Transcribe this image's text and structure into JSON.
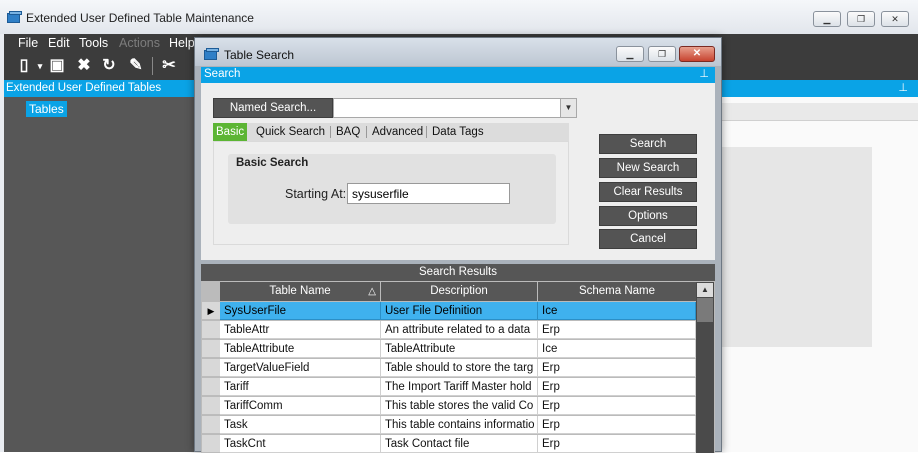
{
  "main": {
    "title": "Extended User Defined Table Maintenance",
    "menu": [
      "File",
      "Edit",
      "Tools",
      "Actions",
      "Help"
    ],
    "panel_title": "Extended User Defined Tables",
    "tree_item": "Tables"
  },
  "dialog": {
    "title": "Table Search",
    "search_panel_title": "Search",
    "named_search_label": "Named Search...",
    "named_search_value": "",
    "tabs": [
      "Basic",
      "Quick Search",
      "BAQ",
      "Advanced",
      "Data Tags"
    ],
    "basic_group_title": "Basic Search",
    "starting_at_label": "Starting At:",
    "starting_at_value": "sysuserfile",
    "buttons": [
      "Search",
      "New Search",
      "Clear Results",
      "Options",
      "Cancel"
    ],
    "results_title": "Search Results",
    "columns": [
      "Table Name",
      "Description",
      "Schema Name"
    ],
    "rows": [
      [
        "SysUserFile",
        "User File Definition",
        "Ice"
      ],
      [
        "TableAttr",
        "An attribute related to a data",
        "Erp"
      ],
      [
        "TableAttribute",
        "TableAttribute",
        "Ice"
      ],
      [
        "TargetValueField",
        "Table should to store the targ",
        "Erp"
      ],
      [
        "Tariff",
        "The Import Tariff Master hold",
        "Erp"
      ],
      [
        "TariffComm",
        "This table stores the valid Co",
        "Erp"
      ],
      [
        "Task",
        "This table contains informatio",
        "Erp"
      ],
      [
        "TaskCnt",
        "Task Contact file",
        "Erp"
      ]
    ],
    "selected_row": 0
  },
  "colors": {
    "accent": "#0aa3e6",
    "active_tab": "#5cb534",
    "selected_row": "#3fb1ee",
    "dark_button": "#545454"
  }
}
